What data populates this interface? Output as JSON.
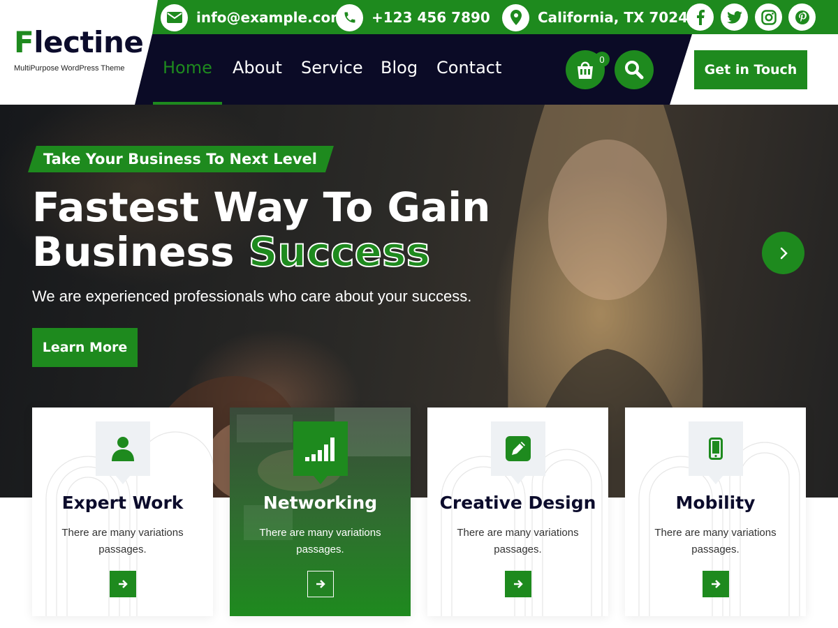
{
  "brand": {
    "name_first_letter": "F",
    "name_rest": "lectine",
    "tagline": "MultiPurpose WordPress Theme"
  },
  "topbar": {
    "email": "info@example.com",
    "phone": "+123 456 7890",
    "location": "California, TX 70240",
    "socials": [
      "facebook-icon",
      "twitter-icon",
      "instagram-icon",
      "pinterest-icon"
    ]
  },
  "nav": {
    "items": [
      {
        "label": "Home",
        "active": true
      },
      {
        "label": "About",
        "active": false
      },
      {
        "label": "Service",
        "active": false
      },
      {
        "label": "Blog",
        "active": false
      },
      {
        "label": "Contact",
        "active": false
      }
    ],
    "cart_count": "0",
    "cta_label": "Get in Touch"
  },
  "hero": {
    "badge": "Take Your Business To Next Level",
    "title_line1": "Fastest Way To Gain",
    "title_line2_plain": "Business ",
    "title_line2_accent": "Success",
    "subtitle": "We are experienced professionals who care about your success.",
    "button_label": "Learn More"
  },
  "features": [
    {
      "title": "Expert Work",
      "desc": "There are many variations passages.",
      "icon": "user-icon",
      "featured": false
    },
    {
      "title": "Networking",
      "desc": "There are many variations passages.",
      "icon": "signal-bars-icon",
      "featured": true
    },
    {
      "title": "Creative Design",
      "desc": "There are many variations passages.",
      "icon": "pencil-icon",
      "featured": false
    },
    {
      "title": "Mobility",
      "desc": "There are many variations passages.",
      "icon": "mobile-icon",
      "featured": false
    }
  ],
  "colors": {
    "accent": "#1e8a1e",
    "navy": "#0b0b26",
    "white": "#ffffff"
  }
}
